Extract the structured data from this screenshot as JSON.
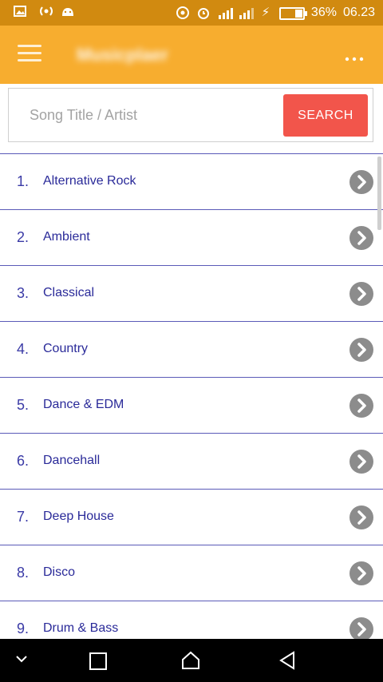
{
  "status_bar": {
    "battery_percent": "36%",
    "time": "06.23"
  },
  "app_bar": {
    "title": "Musicplaer"
  },
  "search": {
    "placeholder": "Song Title / Artist",
    "button_label": "SEARCH"
  },
  "genres": [
    {
      "num": "1.",
      "label": "Alternative Rock"
    },
    {
      "num": "2.",
      "label": "Ambient"
    },
    {
      "num": "3.",
      "label": "Classical"
    },
    {
      "num": "4.",
      "label": "Country"
    },
    {
      "num": "5.",
      "label": "Dance & EDM"
    },
    {
      "num": "6.",
      "label": "Dancehall"
    },
    {
      "num": "7.",
      "label": "Deep House"
    },
    {
      "num": "8.",
      "label": "Disco"
    },
    {
      "num": "9.",
      "label": "Drum & Bass"
    }
  ],
  "colors": {
    "status_bar": "#d18a10",
    "app_bar": "#f7ad2f",
    "search_button": "#f2554b",
    "list_text": "#2a2a99",
    "divider": "#5a5ab8",
    "chevron_bg": "#8c8c8c"
  }
}
